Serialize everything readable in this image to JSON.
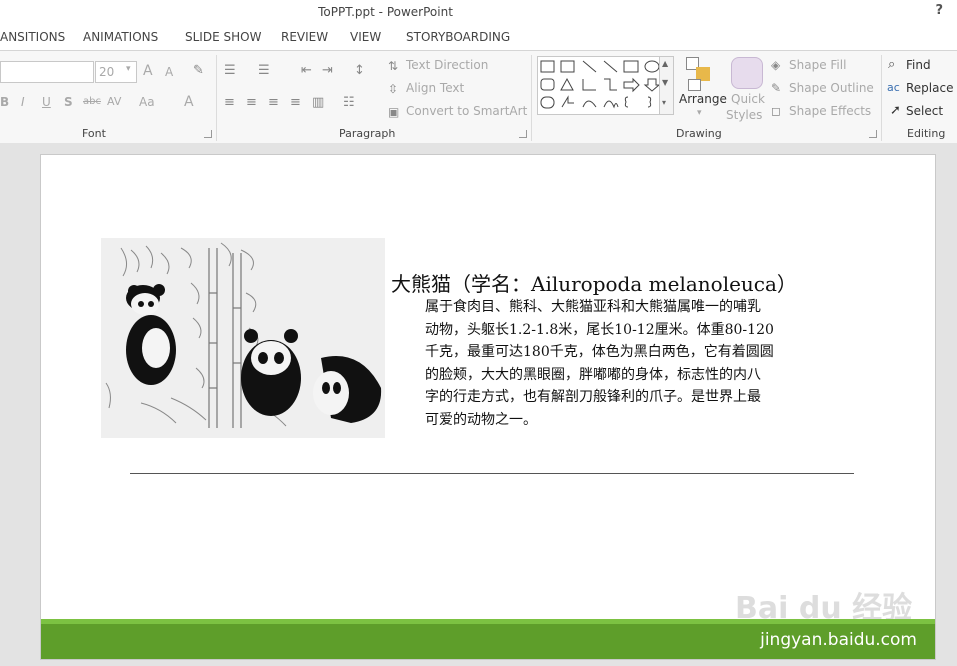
{
  "window": {
    "title": "ToPPT.ppt - PowerPoint",
    "help": "?"
  },
  "tabs": [
    "ANSITIONS",
    "ANIMATIONS",
    "SLIDE SHOW",
    "REVIEW",
    "VIEW",
    "STORYBOARDING"
  ],
  "ribbon": {
    "font": {
      "label": "Font",
      "size_value": "20",
      "grow_label": "A",
      "shrink_label": "A",
      "bold": "B",
      "italic": "I",
      "underline": "U",
      "shadow": "S",
      "strikethrough": "abc",
      "spacing": "AV",
      "case": "Aa",
      "color": "A"
    },
    "paragraph": {
      "label": "Paragraph",
      "text_direction": "Text Direction",
      "align_text": "Align Text",
      "convert_smartart": "Convert to SmartArt"
    },
    "drawing": {
      "label": "Drawing",
      "arrange": "Arrange",
      "quick_styles_1": "Quick",
      "quick_styles_2": "Styles",
      "shape_fill": "Shape Fill",
      "shape_outline": "Shape Outline",
      "shape_effects": "Shape Effects"
    },
    "editing": {
      "label": "Editing",
      "find": "Find",
      "replace": "Replace",
      "select": "Select"
    }
  },
  "slide": {
    "heading": "大熊猫（学名：Ailuropoda melanoleuca）",
    "body_lines": [
      "属于食肉目、熊科、大熊猫亚科和大熊猫属唯一的哺乳",
      "动物，头躯长1.2-1.8米，尾长10-12厘米。体重80-120",
      "千克，最重可达180千克，体色为黑白两色，它有着圆圆",
      "的脸颊，大大的黑眼圈，胖嘟嘟的身体，标志性的内八",
      "字的行走方式，也有解剖刀般锋利的爪子。是世界上最",
      "可爱的动物之一。"
    ],
    "footer_text": "jingyan.baidu.com",
    "watermark": "Bai du 经验"
  },
  "colors": {
    "footer_green": "#5e9e2a",
    "footer_stripe": "#7cc242"
  }
}
